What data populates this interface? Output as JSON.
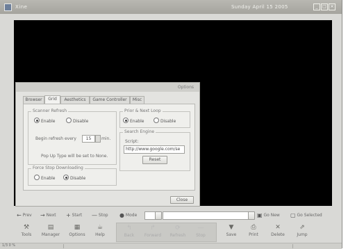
{
  "titlebar": {
    "title": "Xine",
    "clock": "Sunday April 15 2005"
  },
  "dialog": {
    "title": "Options",
    "tabs": [
      "Browser",
      "Grid",
      "Aesthetics",
      "Game Controller",
      "Misc"
    ],
    "active_tab": "Grid",
    "scanner_refresh": {
      "legend": "Scanner Refresh",
      "enable": "Enable",
      "disable": "Disable",
      "selected": "Enable",
      "begin_label": "Begin refresh every",
      "interval": "15",
      "unit": "min.",
      "note": "Pop Up Type will be set to None."
    },
    "prior_next_loop": {
      "legend": "Prior & Next Loop",
      "enable": "Enable",
      "disable": "Disable",
      "selected": "Enable"
    },
    "search_engine": {
      "legend": "Search Engine",
      "script_label": "Script:",
      "script_value": "http://www.google.com/se",
      "reset_label": "Reset"
    },
    "force_stop": {
      "legend": "Force Stop Downloading",
      "enable": "Enable",
      "disable": "Disable",
      "selected": "Disable"
    },
    "close_label": "Close"
  },
  "toolbar_top": {
    "prev": "Prev",
    "next": "Next",
    "start": "Start",
    "stop": "Stop",
    "mode": "Mode",
    "go_new": "Go New",
    "go_selected": "Go Selected"
  },
  "toolbar_bottom": {
    "tools": "Tools",
    "manager": "Manager",
    "options": "Options",
    "help": "Help",
    "back": "Back",
    "forward": "Forward",
    "refresh": "Refresh",
    "stop": "Stop",
    "save": "Save",
    "print": "Print",
    "delete": "Delete",
    "jump": "Jump"
  },
  "status": {
    "left": "1/3 0 %"
  }
}
